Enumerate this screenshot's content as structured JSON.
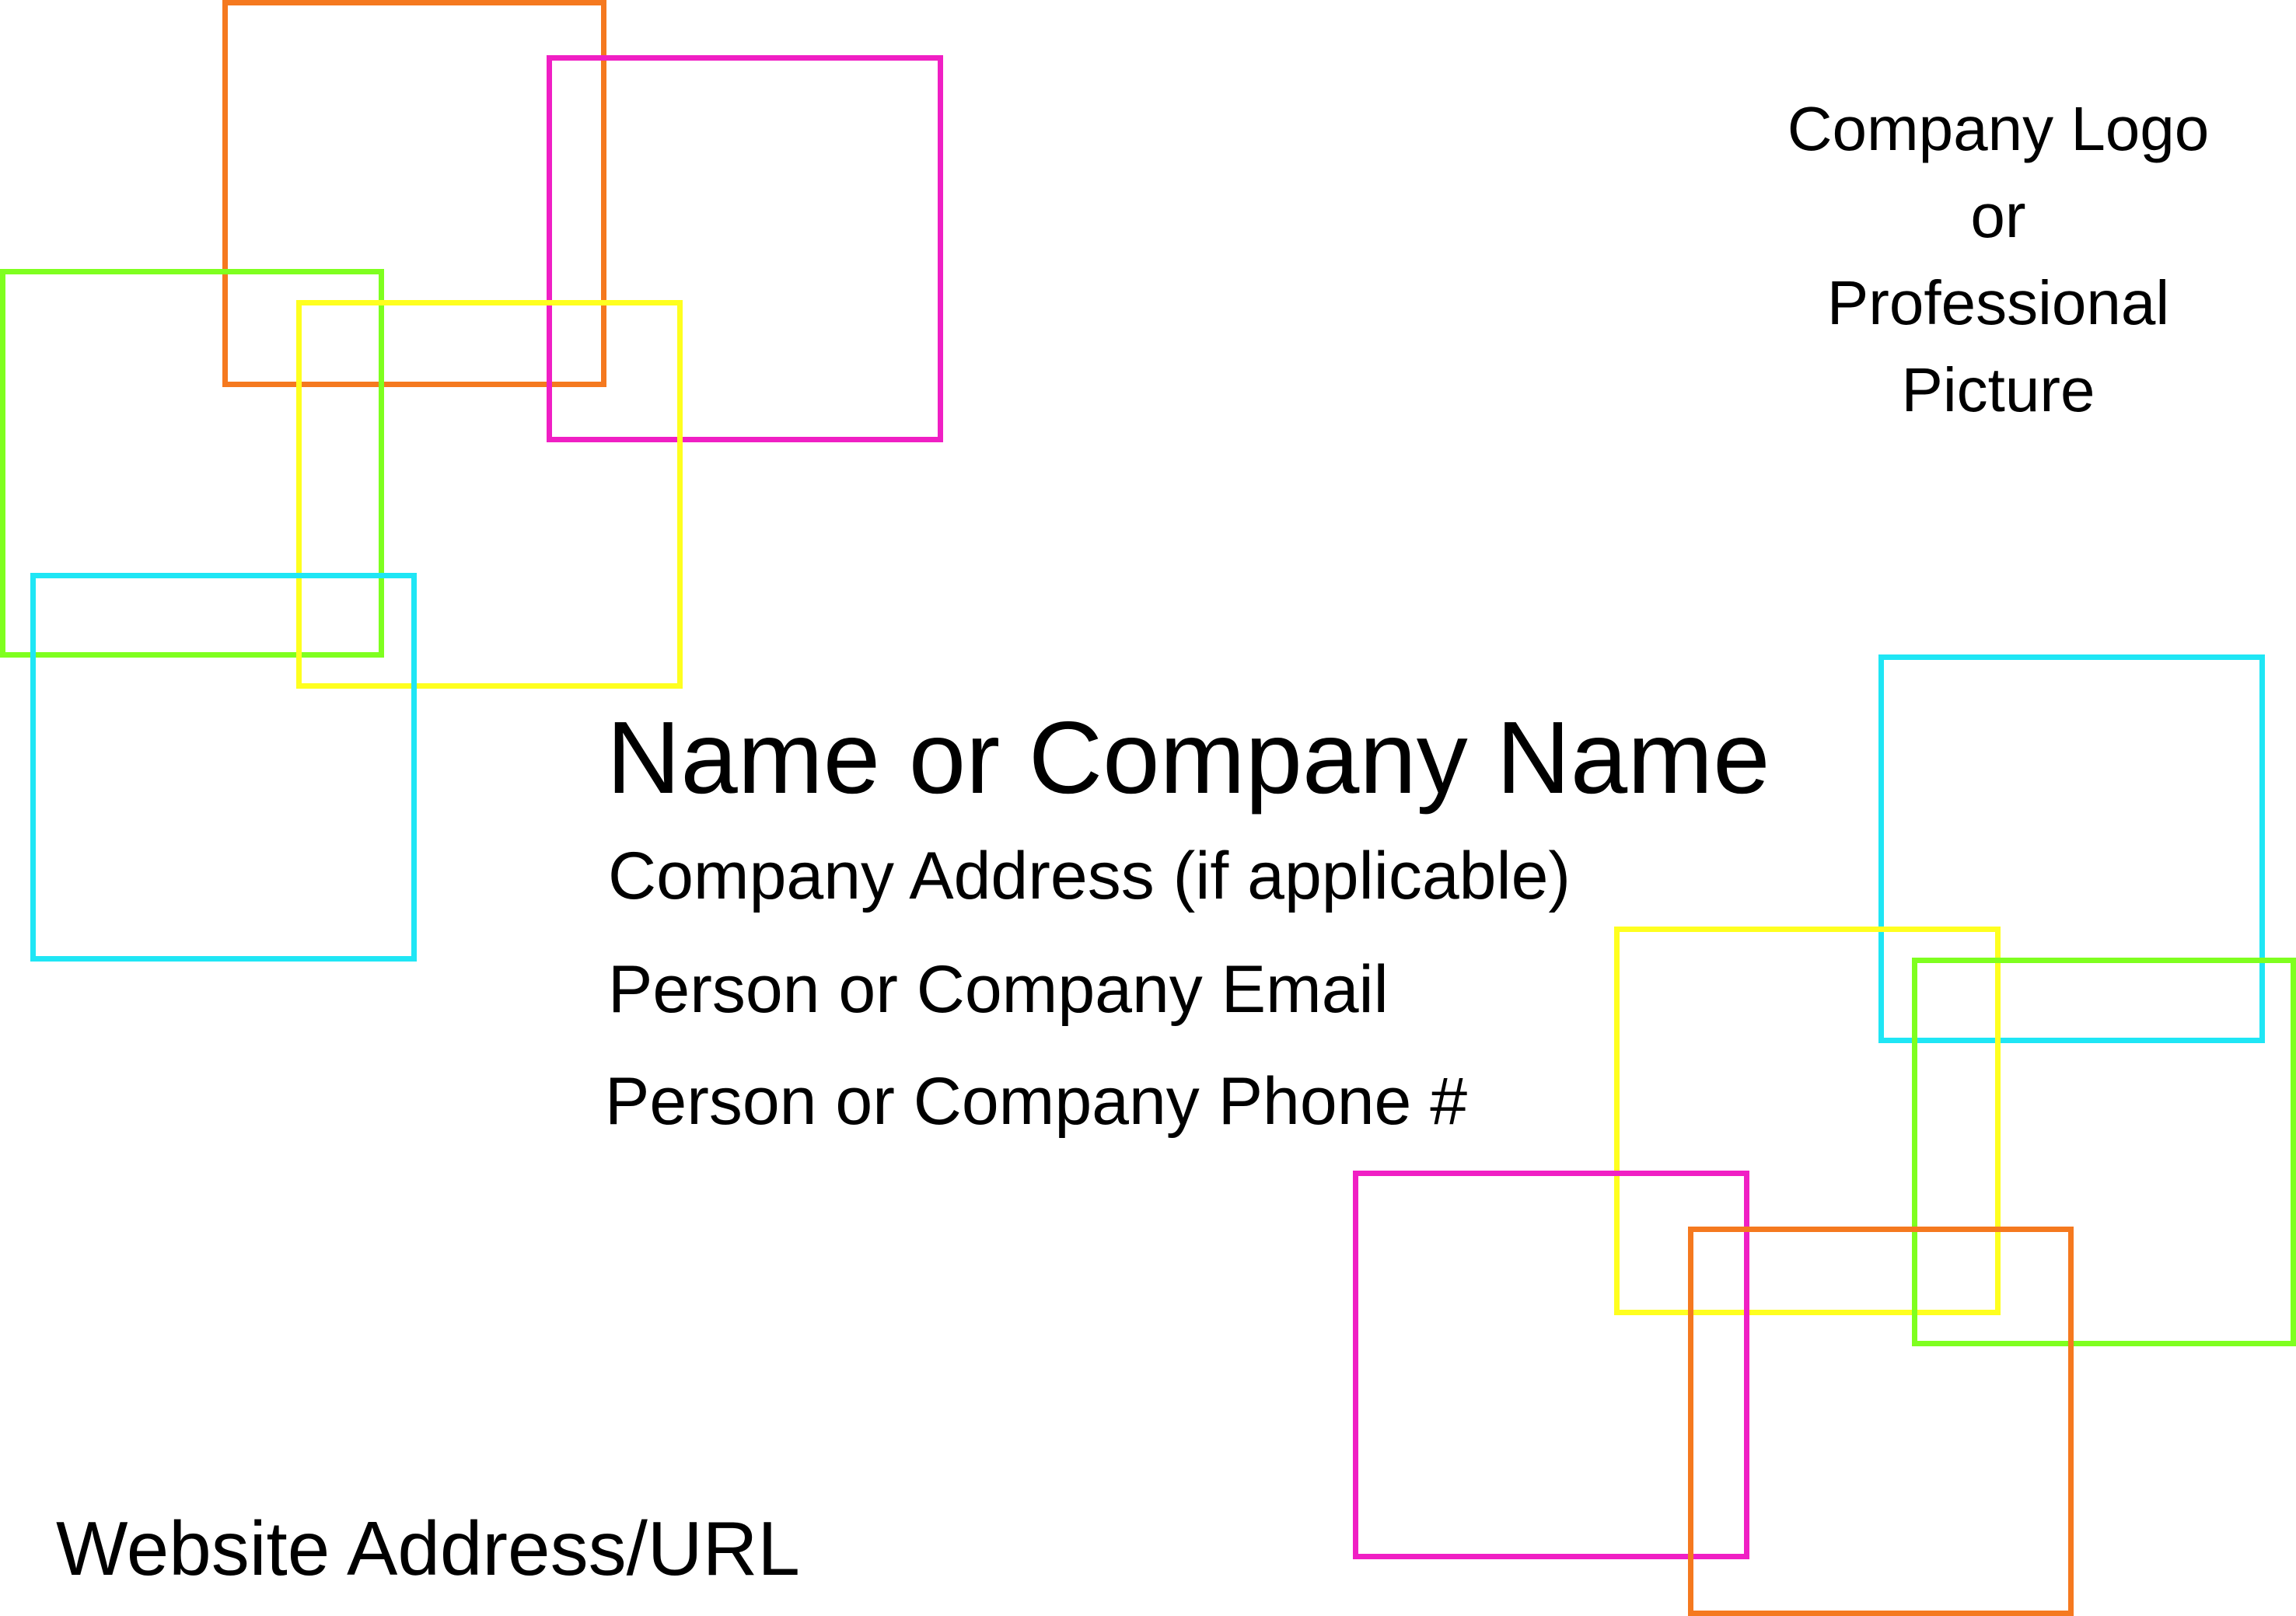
{
  "colors": {
    "orange": "#f5791f",
    "magenta": "#f01fc4",
    "lime": "#7fff1f",
    "yellow": "#ffff1f",
    "cyan": "#1fe6f5",
    "text": "#000000",
    "background": "#ffffff"
  },
  "logo_placeholder": {
    "lines": [
      "Company Logo",
      "or",
      "Professional",
      "Picture"
    ]
  },
  "card": {
    "name": "Name or Company Name",
    "address": "Company Address (if applicable)",
    "email": "Person or Company Email",
    "phone": "Person or Company Phone #",
    "website": "Website Address/URL"
  }
}
